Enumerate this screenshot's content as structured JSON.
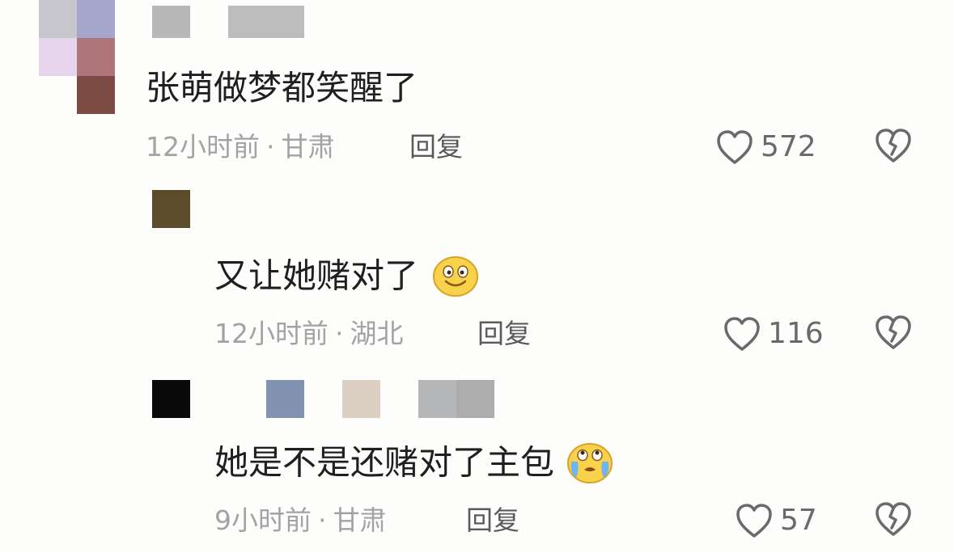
{
  "comments": [
    {
      "text": "张萌做梦都笑醒了",
      "time": "12小时前",
      "location": "甘肃",
      "reply_label": "回复",
      "likes": "572",
      "emoji": null
    },
    {
      "text": "又让她赌对了",
      "time": "12小时前",
      "location": "湖北",
      "reply_label": "回复",
      "likes": "116",
      "emoji": "smile-emoji"
    },
    {
      "text": "她是不是还赌对了主包",
      "time": "9小时前",
      "location": "甘肃",
      "reply_label": "回复",
      "likes": "57",
      "emoji": "crying-emoji"
    }
  ],
  "separator": "·",
  "icons": {
    "like": "heart-outline-icon",
    "dislike": "broken-heart-icon"
  },
  "colors": {
    "background": "#fdfdfb",
    "text": "#1f1f1f",
    "meta": "#a3a3a3",
    "icon": "#6a6a6a",
    "emoji_yellow": "#f8d24a"
  }
}
